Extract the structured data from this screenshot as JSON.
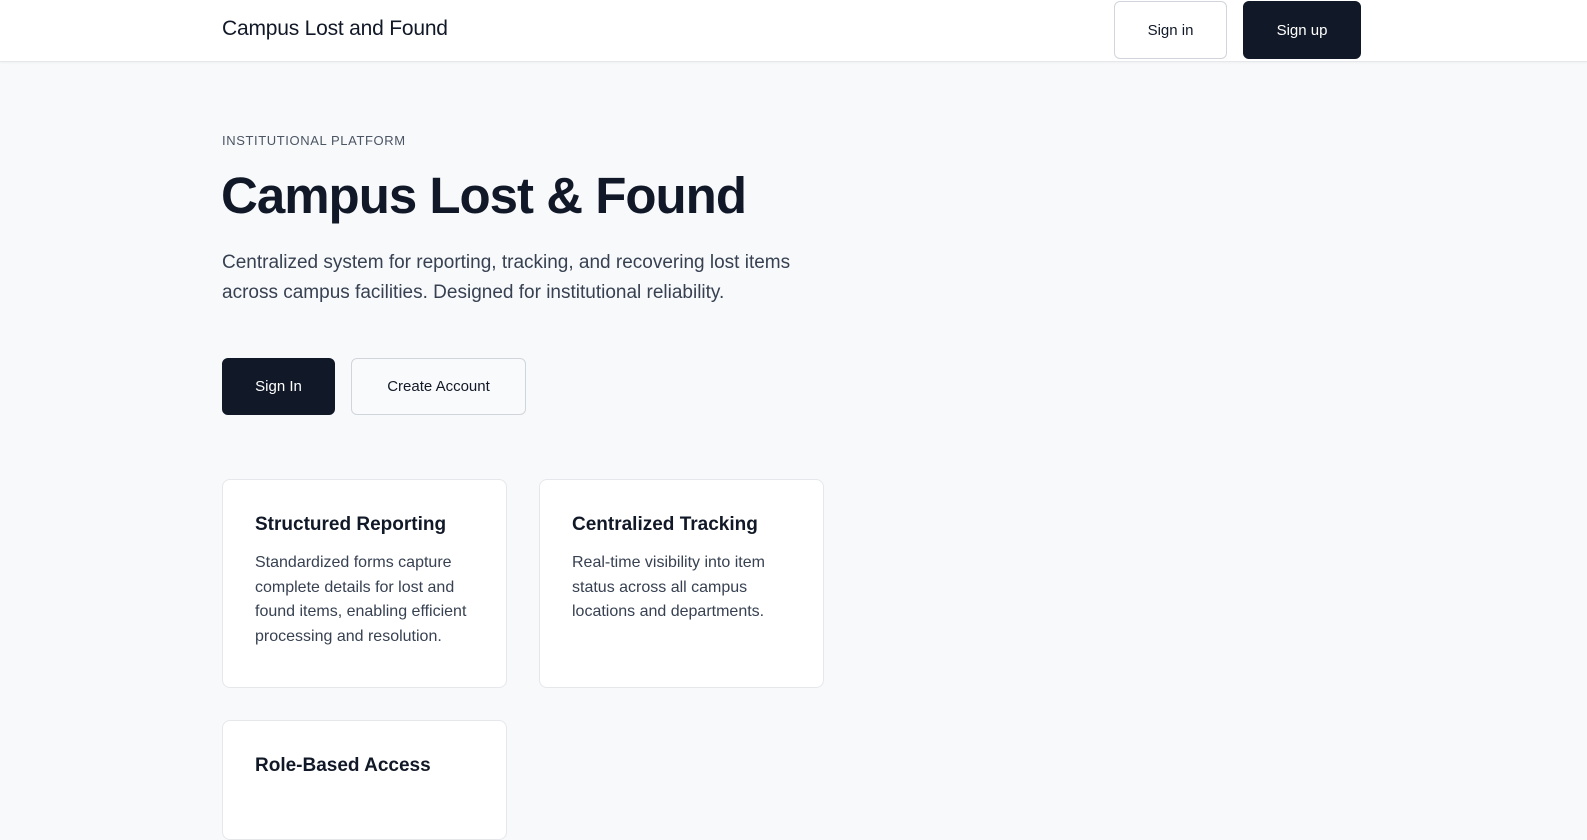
{
  "header": {
    "brand": "Campus Lost and Found",
    "sign_in_label": "Sign in",
    "sign_up_label": "Sign up"
  },
  "hero": {
    "eyebrow": "INSTITUTIONAL PLATFORM",
    "title": "Campus Lost & Found",
    "description": "Centralized system for reporting, tracking, and recovering lost items across campus facilities. Designed for institutional reliability.",
    "primary_button": "Sign In",
    "secondary_button": "Create Account"
  },
  "features": [
    {
      "title": "Structured Reporting",
      "text": "Standardized forms capture complete details for lost and found items, enabling efficient processing and resolution."
    },
    {
      "title": "Centralized Tracking",
      "text": "Real-time visibility into item status across all campus locations and departments."
    },
    {
      "title": "Role-Based Access",
      "text": ""
    }
  ],
  "colors": {
    "background": "#f8f9fb",
    "surface": "#ffffff",
    "primary": "#111827",
    "border": "#e5e7eb",
    "muted_text": "#374151"
  }
}
